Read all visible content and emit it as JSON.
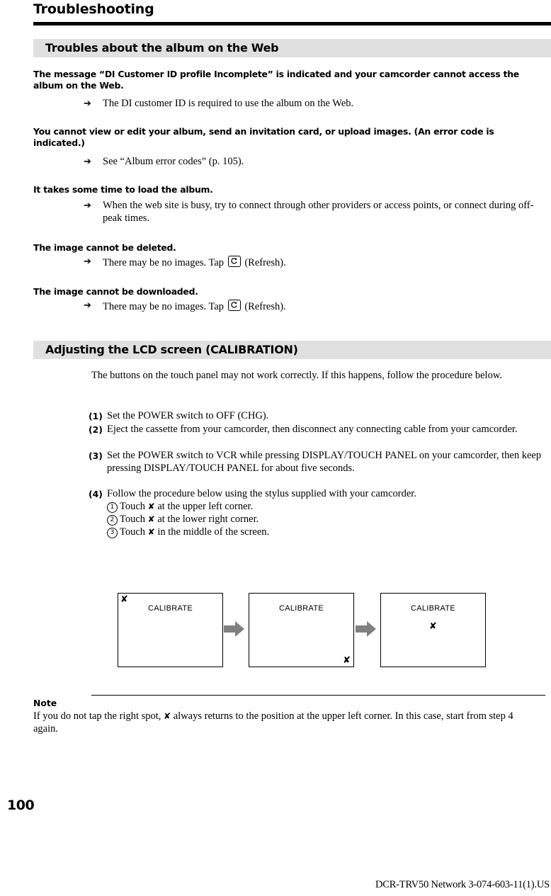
{
  "page": {
    "title": "Troubleshooting",
    "folio": "100",
    "footer": "DCR-TRV50 Network 3-074-603-11(1).US"
  },
  "sections": [
    {
      "heading": "Troubles about the album on the Web",
      "entries": [
        {
          "symptom": "The message “DI Customer ID profile Incomplete” is indicated and your camcorder cannot access the album on the Web.",
          "arrow": "➔",
          "remedy": "The DI customer ID is required to use the album on the Web."
        },
        {
          "symptom": "You cannot view or edit your album, send an invitation card, or upload images. (An error code is indicated.)",
          "arrow": "➔",
          "remedy": "See “Album error codes” (p. 105)."
        },
        {
          "symptom": "It takes some time to load the album.",
          "arrow": "➔",
          "remedy": "When the web site is busy, try to connect through other providers or access points, or connect during off-peak times."
        },
        {
          "symptom": "The image cannot be deleted.",
          "arrow": "➔",
          "remedy_prefix": "There may be no images. Tap",
          "remedy_icon": "refresh-icon",
          "remedy_suffix": "(Refresh)."
        },
        {
          "symptom": "The image cannot be downloaded.",
          "arrow": "➔",
          "remedy_prefix": "There may be no images. Tap",
          "remedy_icon": "refresh-icon",
          "remedy_suffix": "(Refresh)."
        }
      ]
    },
    {
      "heading": "Adjusting the LCD screen (CALIBRATION)",
      "intro": "The buttons on the touch panel may not work correctly. If this happens, follow the procedure below.",
      "steps": [
        {
          "num": "(1)",
          "text": "Set the POWER switch to OFF (CHG)."
        },
        {
          "num": "(2)",
          "text": "Eject the cassette from your camcorder, then disconnect any connecting cable from your camcorder."
        },
        {
          "num": "(3)",
          "text": "Set the POWER switch to VCR while pressing DISPLAY/TOUCH PANEL on your camcorder, then keep pressing DISPLAY/TOUCH PANEL for about five seconds."
        },
        {
          "num": "(4)",
          "text": "Follow the procedure below using the stylus supplied with your camcorder."
        }
      ],
      "substeps": [
        {
          "num": "1",
          "prefix": "Touch",
          "mark": "✘",
          "suffix": "at the upper left corner."
        },
        {
          "num": "2",
          "prefix": "Touch",
          "mark": "✘",
          "suffix": "at the lower right corner."
        },
        {
          "num": "3",
          "prefix": "Touch",
          "mark": "✘",
          "suffix": "in the middle of the screen."
        }
      ],
      "diagram": {
        "screens": [
          {
            "label": "CALIBRATE",
            "mark": "✘",
            "mark_position": "upper-left"
          },
          {
            "label": "CALIBRATE",
            "mark": "✘",
            "mark_position": "lower-right"
          },
          {
            "label": "CALIBRATE",
            "mark": "✘",
            "mark_position": "middle"
          }
        ],
        "arrow_color": "#808080"
      },
      "note": {
        "title": "Note",
        "prefix": "If you do not tap the right spot,",
        "mark": "✘",
        "suffix": "always returns to the position at the upper left corner. In this case, start from step 4 again."
      }
    }
  ],
  "colors": {
    "band_background": "#e0e0e0",
    "rule": "#000000",
    "arrow_gray": "#808080"
  }
}
